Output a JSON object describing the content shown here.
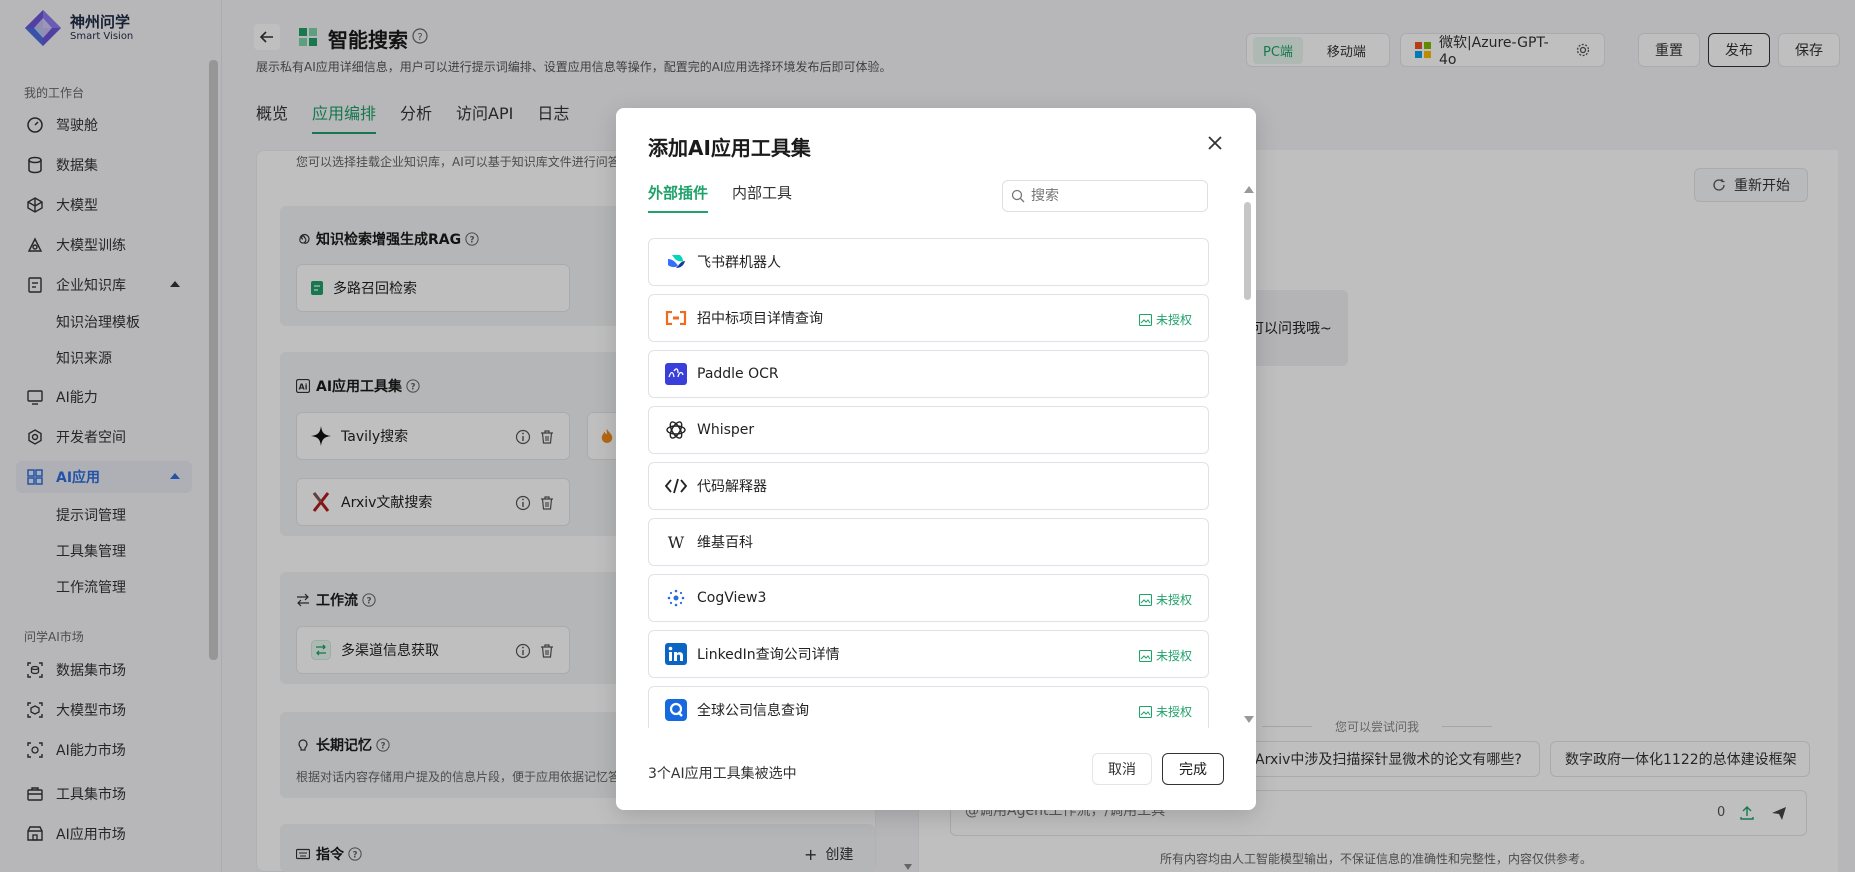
{
  "brand": {
    "name": "神州问学",
    "sub": "Smart Vision"
  },
  "sidebar": {
    "group1": "我的工作台",
    "items": [
      {
        "label": "驾驶舱",
        "icon": "dashboard-icon"
      },
      {
        "label": "数据集",
        "icon": "database-icon"
      },
      {
        "label": "大模型",
        "icon": "cube-icon"
      },
      {
        "label": "大模型训练",
        "icon": "training-icon"
      },
      {
        "label": "企业知识库",
        "icon": "knowledge-icon"
      },
      {
        "label": "AI能力",
        "icon": "monitor-icon"
      },
      {
        "label": "开发者空间",
        "icon": "developer-icon"
      },
      {
        "label": "AI应用",
        "icon": "grid-icon"
      }
    ],
    "knowledge_sub": [
      "知识治理模板",
      "知识来源"
    ],
    "ai_app_sub": [
      "提示词管理",
      "工具集管理",
      "工作流管理"
    ],
    "group2": "问学AI市场",
    "market": [
      {
        "label": "数据集市场",
        "icon": "dataset-market-icon"
      },
      {
        "label": "大模型市场",
        "icon": "model-market-icon"
      },
      {
        "label": "AI能力市场",
        "icon": "ai-market-icon"
      },
      {
        "label": "工具集市场",
        "icon": "toolbox-market-icon"
      },
      {
        "label": "AI应用市场",
        "icon": "app-market-icon"
      }
    ]
  },
  "header": {
    "title": "智能搜索",
    "desc": "展示私有AI应用详细信息，用户可以进行提示词编排、设置应用信息等操作，配置完的AI应用选择环境发布后即可体验。",
    "tabs": [
      "概览",
      "应用编排",
      "分析",
      "访问API",
      "日志"
    ],
    "seg": [
      "PC端",
      "移动端"
    ],
    "model": "微软|Azure-GPT-4o",
    "reset": "重置",
    "publish": "发布",
    "save": "保存"
  },
  "left": {
    "kb_hint": "您可以选择挂载企业知识库，AI可以基于知识库文件进行问答",
    "rag_title": "知识检索增强生成RAG",
    "rag_chip": "多路召回检索",
    "tools_title": "AI应用工具集",
    "tool_chips": [
      "Tavily搜索",
      "Arxiv文献搜索"
    ],
    "workflow_title": "工作流",
    "workflow_chip": "多渠道信息获取",
    "memory_title": "长期记忆",
    "memory_desc": "根据对话内容存储用户提及的信息片段，便于应用依据记忆答",
    "cmd_title": "指令",
    "cmd_create": "创建"
  },
  "right": {
    "restart": "重新开始",
    "bubble": "可以问我哦~",
    "try": "您可以尝试问我",
    "suggestions": [
      "Arxiv中涉及扫描探针显微术的论文有哪些?",
      "数字政府一体化1122的总体建设框架"
    ],
    "placeholder": "@调用Agent工作流，/调用工具",
    "count": "0",
    "disclaimer": "所有内容均由人工智能模型输出，不保证信息的准确性和完整性，内容仅供参考。"
  },
  "modal": {
    "title": "添加AI应用工具集",
    "tabs": [
      "外部插件",
      "内部工具"
    ],
    "search_placeholder": "搜索",
    "unauth": "未授权",
    "tools": [
      {
        "name": "飞书群机器人",
        "icon": "feishu-icon",
        "unauth": false
      },
      {
        "name": "招中标项目详情查询",
        "icon": "bid-icon",
        "unauth": true
      },
      {
        "name": "Paddle OCR",
        "icon": "paddle-ocr-icon",
        "unauth": false
      },
      {
        "name": "Whisper",
        "icon": "openai-icon",
        "unauth": false
      },
      {
        "name": "代码解释器",
        "icon": "code-icon",
        "unauth": false
      },
      {
        "name": "维基百科",
        "icon": "wikipedia-icon",
        "unauth": false
      },
      {
        "name": "CogView3",
        "icon": "cogview-icon",
        "unauth": true
      },
      {
        "name": "LinkedIn查询公司详情",
        "icon": "linkedin-icon",
        "unauth": true
      },
      {
        "name": "全球公司信息查询",
        "icon": "company-search-icon",
        "unauth": true
      }
    ],
    "count_text": "3个AI应用工具集被选中",
    "cancel": "取消",
    "ok": "完成"
  },
  "colors": {
    "accent": "#1fa16a",
    "active_blue": "#2f6fde"
  }
}
